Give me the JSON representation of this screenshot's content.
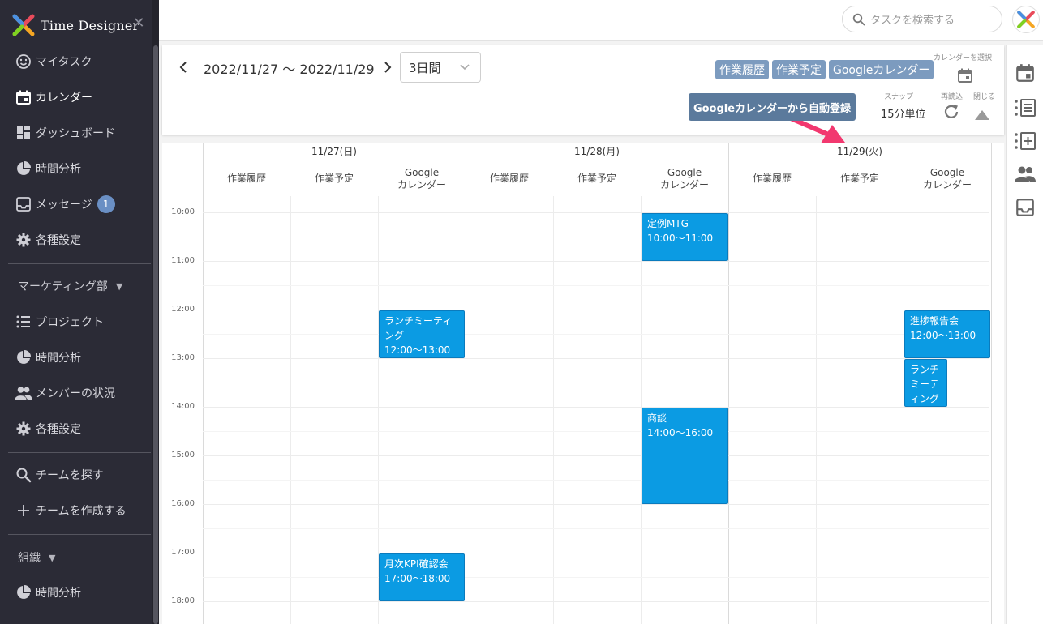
{
  "app": {
    "brand": "Time Designer"
  },
  "sidebar": {
    "items": [
      {
        "label": "マイタスク",
        "icon": "smile-icon"
      },
      {
        "label": "カレンダー",
        "icon": "calendar-icon",
        "active": true
      },
      {
        "label": "ダッシュボード",
        "icon": "dashboard-icon"
      },
      {
        "label": "時間分析",
        "icon": "pie-chart-icon"
      },
      {
        "label": "メッセージ",
        "icon": "inbox-icon",
        "badge": "1"
      },
      {
        "label": "各種設定",
        "icon": "gear-icon"
      }
    ],
    "team_section": {
      "label": "マーケティング部",
      "caret": "▼"
    },
    "team_items": [
      {
        "label": "プロジェクト",
        "icon": "list-icon"
      },
      {
        "label": "時間分析",
        "icon": "pie-chart-icon"
      },
      {
        "label": "メンバーの状況",
        "icon": "people-icon"
      },
      {
        "label": "各種設定",
        "icon": "gear-icon"
      }
    ],
    "team_actions": [
      {
        "label": "チームを探す",
        "icon": "search-icon"
      },
      {
        "label": "チームを作成する",
        "icon": "plus-icon"
      }
    ],
    "org_section": {
      "label": "組織",
      "caret": "▼"
    },
    "org_items": [
      {
        "label": "時間分析",
        "icon": "pie-chart-icon"
      }
    ]
  },
  "topbar": {
    "search_placeholder": "タスクを検索する"
  },
  "header": {
    "date_range": "2022/11/27 〜 2022/11/29",
    "view_value": "3日間",
    "tags": [
      "作業履歴",
      "作業予定",
      "Googleカレンダー"
    ],
    "auto_register_label": "Googleカレンダーから自動登録",
    "calendar_select_label": "カレンダーを選択",
    "snap_label": "スナップ",
    "snap_value": "15分単位",
    "reload_label": "再読込",
    "close_label": "閉じる",
    "accent_arrow_color": "#f2386f"
  },
  "calendar": {
    "days": [
      {
        "label": "11/27(日)",
        "columns": [
          "作業履歴",
          "作業予定",
          "Google\nカレンダー"
        ]
      },
      {
        "label": "11/28(月)",
        "columns": [
          "作業履歴",
          "作業予定",
          "Google\nカレンダー"
        ]
      },
      {
        "label": "11/29(火)",
        "columns": [
          "作業履歴",
          "作業予定",
          "Google\nカレンダー"
        ]
      }
    ],
    "hours": [
      "10:00",
      "11:00",
      "12:00",
      "13:00",
      "14:00",
      "15:00",
      "16:00",
      "17:00",
      "18:00"
    ],
    "events": [
      {
        "day": 0,
        "col": 2,
        "title": "ランチミーティング",
        "time": "12:00〜13:00",
        "start": 12,
        "end": 13
      },
      {
        "day": 0,
        "col": 2,
        "title": "月次KPI確認会",
        "time": "17:00〜18:00",
        "start": 17,
        "end": 18
      },
      {
        "day": 1,
        "col": 2,
        "title": "定例MTG",
        "time": "10:00〜11:00",
        "start": 10,
        "end": 11
      },
      {
        "day": 1,
        "col": 2,
        "title": "商談",
        "time": "14:00〜16:00",
        "start": 14,
        "end": 16
      },
      {
        "day": 2,
        "col": 2,
        "title": "進捗報告会",
        "time": "12:00〜13:00",
        "start": 12,
        "end": 13
      },
      {
        "day": 2,
        "col": 2,
        "title": "ランチミーティング",
        "time": "",
        "start": 13,
        "end": 14,
        "narrow": true
      }
    ],
    "event_color": "#0b9be3"
  },
  "right_rail": {
    "icons": [
      "calendar-icon",
      "task-list-icon",
      "add-task-icon",
      "people-icon",
      "inbox-icon"
    ]
  }
}
